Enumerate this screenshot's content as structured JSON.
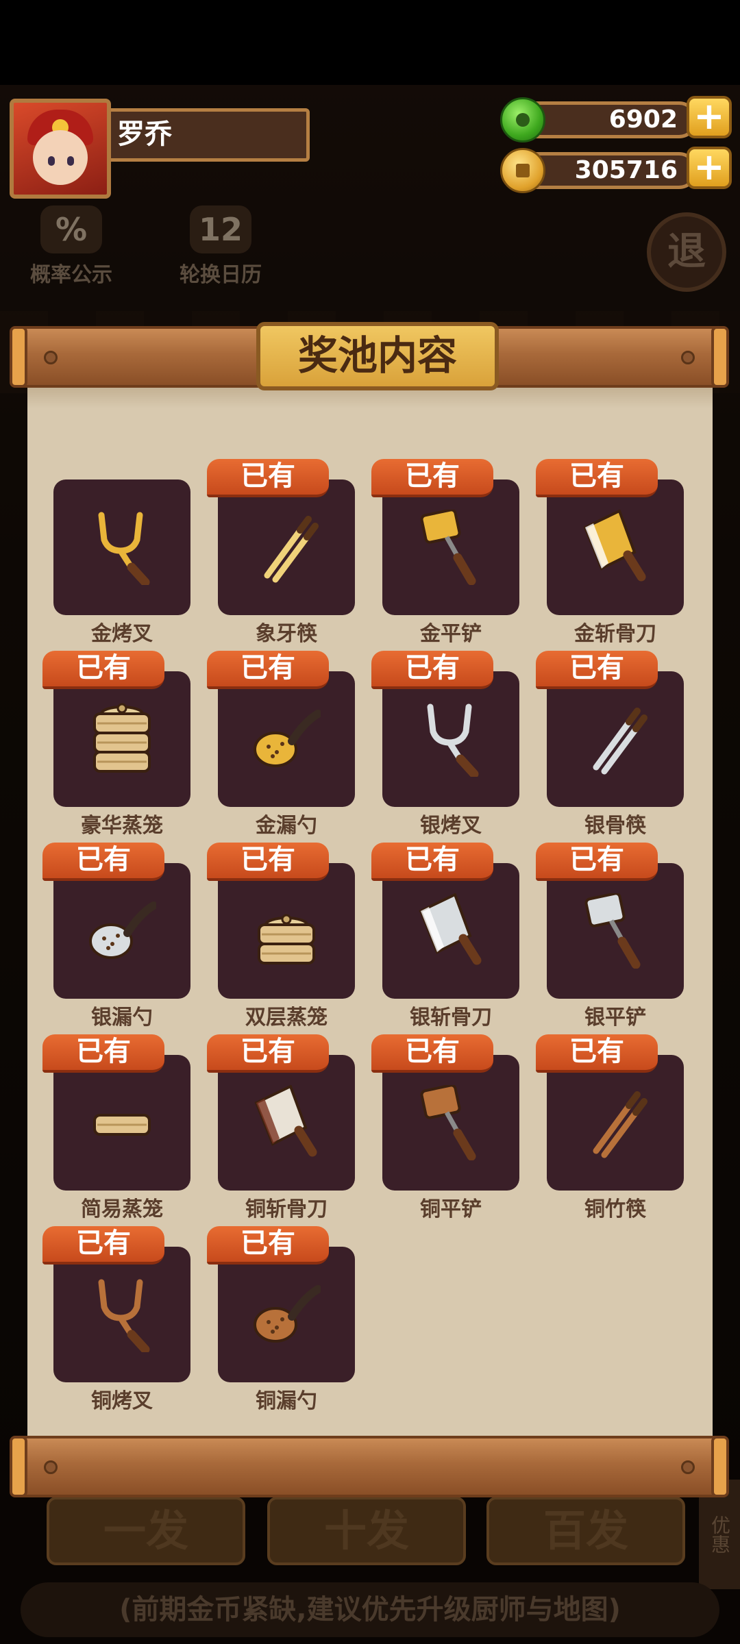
{
  "player": {
    "name": "罗乔"
  },
  "resources": {
    "jade": "6902",
    "coins": "305716",
    "plus_label": "+"
  },
  "background": {
    "tools": [
      {
        "label": "概率公示",
        "icon": "%"
      },
      {
        "label": "轮换日历",
        "icon": "12"
      }
    ],
    "exit_label": "退",
    "draw_buttons": [
      "一发",
      "十发",
      "百发"
    ],
    "side_tab_label": "优惠",
    "hint": "(前期金币紧缺,建议优先升级厨师与地图)"
  },
  "modal": {
    "title": "奖池内容",
    "owned_badge": "已有",
    "items": [
      {
        "name": "金烤叉",
        "owned": false,
        "icon": "fork-gold"
      },
      {
        "name": "象牙筷",
        "owned": true,
        "icon": "chopsticks-ivory"
      },
      {
        "name": "金平铲",
        "owned": true,
        "icon": "spatula-gold"
      },
      {
        "name": "金斩骨刀",
        "owned": true,
        "icon": "cleaver-gold"
      },
      {
        "name": "豪华蒸笼",
        "owned": true,
        "icon": "steamer-deluxe"
      },
      {
        "name": "金漏勺",
        "owned": true,
        "icon": "ladle-gold"
      },
      {
        "name": "银烤叉",
        "owned": true,
        "icon": "fork-silver"
      },
      {
        "name": "银骨筷",
        "owned": true,
        "icon": "chopsticks-silver"
      },
      {
        "name": "银漏勺",
        "owned": true,
        "icon": "ladle-silver"
      },
      {
        "name": "双层蒸笼",
        "owned": true,
        "icon": "steamer-double"
      },
      {
        "name": "银斩骨刀",
        "owned": true,
        "icon": "cleaver-silver"
      },
      {
        "name": "银平铲",
        "owned": true,
        "icon": "spatula-silver"
      },
      {
        "name": "简易蒸笼",
        "owned": true,
        "icon": "steamer-simple"
      },
      {
        "name": "铜斩骨刀",
        "owned": true,
        "icon": "cleaver-copper"
      },
      {
        "name": "铜平铲",
        "owned": true,
        "icon": "spatula-copper"
      },
      {
        "name": "铜竹筷",
        "owned": true,
        "icon": "chopsticks-copper"
      },
      {
        "name": "铜烤叉",
        "owned": true,
        "icon": "fork-copper"
      },
      {
        "name": "铜漏勺",
        "owned": true,
        "icon": "ladle-copper"
      }
    ]
  },
  "colors": {
    "gold": "#e9b53a",
    "silver": "#d9dde0",
    "copper": "#b8713a",
    "ivory": "#f0d27a",
    "card": "#3a1f28",
    "badge": "#d95a24"
  }
}
